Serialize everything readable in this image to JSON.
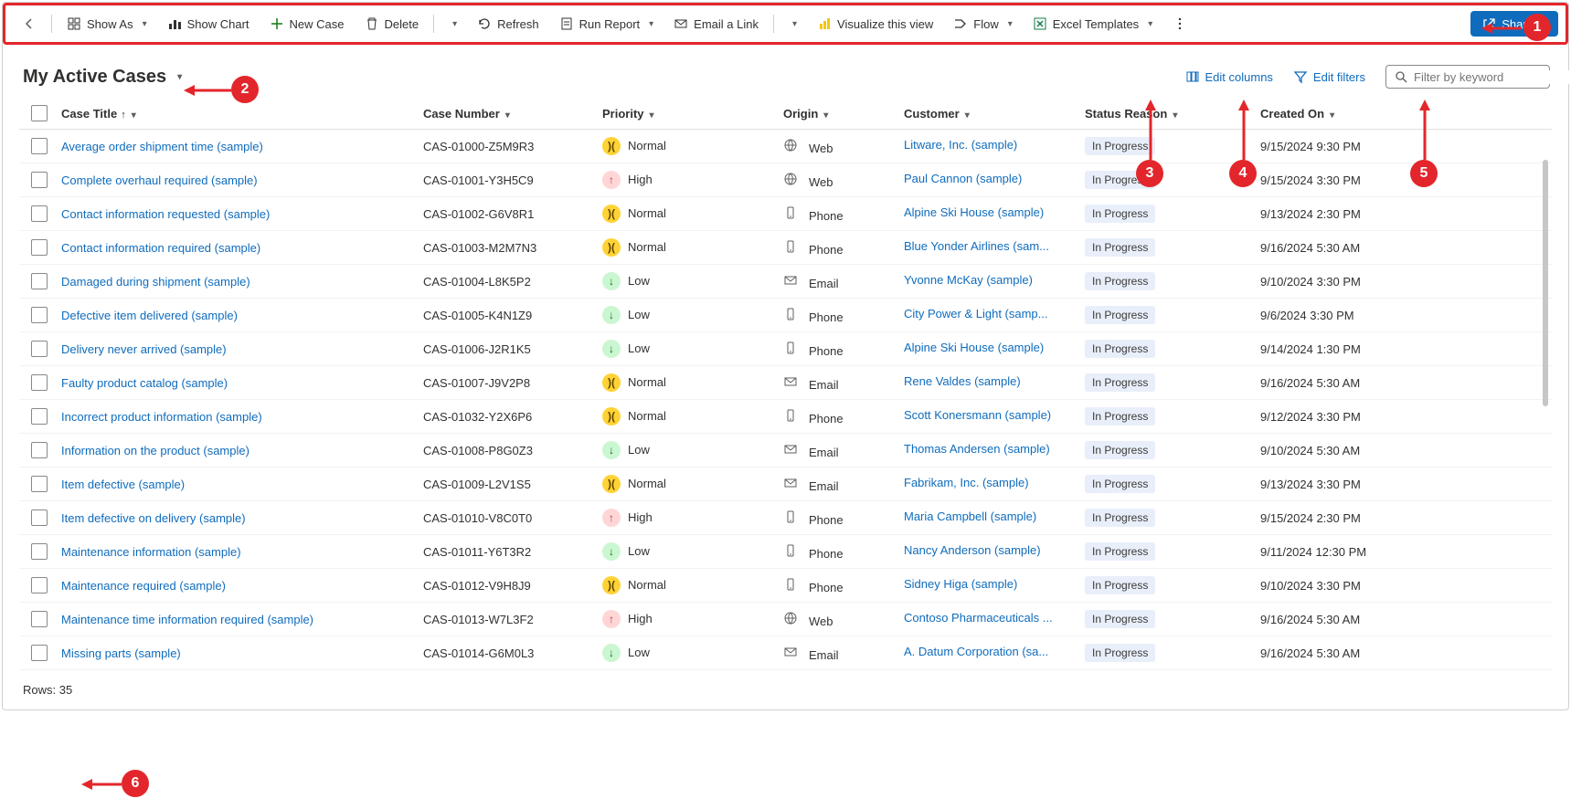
{
  "commands": {
    "showAs": "Show As",
    "showChart": "Show Chart",
    "newCase": "New Case",
    "delete": "Delete",
    "refresh": "Refresh",
    "runReport": "Run Report",
    "emailLink": "Email a Link",
    "visualize": "Visualize this view",
    "flow": "Flow",
    "excel": "Excel Templates",
    "share": "Share"
  },
  "view": {
    "title": "My Active Cases",
    "editColumns": "Edit columns",
    "editFilters": "Edit filters",
    "searchPlaceholder": "Filter by keyword"
  },
  "columns": {
    "title": "Case Title",
    "case": "Case Number",
    "priority": "Priority",
    "origin": "Origin",
    "customer": "Customer",
    "status": "Status Reason",
    "created": "Created On"
  },
  "footer": {
    "rows": "Rows: 35"
  },
  "rows": [
    {
      "title": "Average order shipment time (sample)",
      "case": "CAS-01000-Z5M9R3",
      "priority": "Normal",
      "priLevel": "normal",
      "origin": "Web",
      "originIcon": "web",
      "customer": "Litware, Inc. (sample)",
      "status": "In Progress",
      "created": "9/15/2024 9:30 PM"
    },
    {
      "title": "Complete overhaul required (sample)",
      "case": "CAS-01001-Y3H5C9",
      "priority": "High",
      "priLevel": "high",
      "origin": "Web",
      "originIcon": "web",
      "customer": "Paul Cannon (sample)",
      "status": "In Progress",
      "created": "9/15/2024 3:30 PM"
    },
    {
      "title": "Contact information requested (sample)",
      "case": "CAS-01002-G6V8R1",
      "priority": "Normal",
      "priLevel": "normal",
      "origin": "Phone",
      "originIcon": "phone",
      "customer": "Alpine Ski House (sample)",
      "status": "In Progress",
      "created": "9/13/2024 2:30 PM"
    },
    {
      "title": "Contact information required (sample)",
      "case": "CAS-01003-M2M7N3",
      "priority": "Normal",
      "priLevel": "normal",
      "origin": "Phone",
      "originIcon": "phone",
      "customer": "Blue Yonder Airlines (sam...",
      "status": "In Progress",
      "created": "9/16/2024 5:30 AM"
    },
    {
      "title": "Damaged during shipment (sample)",
      "case": "CAS-01004-L8K5P2",
      "priority": "Low",
      "priLevel": "low",
      "origin": "Email",
      "originIcon": "email",
      "customer": "Yvonne McKay (sample)",
      "status": "In Progress",
      "created": "9/10/2024 3:30 PM"
    },
    {
      "title": "Defective item delivered (sample)",
      "case": "CAS-01005-K4N1Z9",
      "priority": "Low",
      "priLevel": "low",
      "origin": "Phone",
      "originIcon": "phone",
      "customer": "City Power & Light (samp...",
      "status": "In Progress",
      "created": "9/6/2024 3:30 PM"
    },
    {
      "title": "Delivery never arrived (sample)",
      "case": "CAS-01006-J2R1K5",
      "priority": "Low",
      "priLevel": "low",
      "origin": "Phone",
      "originIcon": "phone",
      "customer": "Alpine Ski House (sample)",
      "status": "In Progress",
      "created": "9/14/2024 1:30 PM"
    },
    {
      "title": "Faulty product catalog (sample)",
      "case": "CAS-01007-J9V2P8",
      "priority": "Normal",
      "priLevel": "normal",
      "origin": "Email",
      "originIcon": "email",
      "customer": "Rene Valdes (sample)",
      "status": "In Progress",
      "created": "9/16/2024 5:30 AM"
    },
    {
      "title": "Incorrect product information (sample)",
      "case": "CAS-01032-Y2X6P6",
      "priority": "Normal",
      "priLevel": "normal",
      "origin": "Phone",
      "originIcon": "phone",
      "customer": "Scott Konersmann (sample)",
      "status": "In Progress",
      "created": "9/12/2024 3:30 PM"
    },
    {
      "title": "Information on the product (sample)",
      "case": "CAS-01008-P8G0Z3",
      "priority": "Low",
      "priLevel": "low",
      "origin": "Email",
      "originIcon": "email",
      "customer": "Thomas Andersen (sample)",
      "status": "In Progress",
      "created": "9/10/2024 5:30 AM"
    },
    {
      "title": "Item defective (sample)",
      "case": "CAS-01009-L2V1S5",
      "priority": "Normal",
      "priLevel": "normal",
      "origin": "Email",
      "originIcon": "email",
      "customer": "Fabrikam, Inc. (sample)",
      "status": "In Progress",
      "created": "9/13/2024 3:30 PM"
    },
    {
      "title": "Item defective on delivery (sample)",
      "case": "CAS-01010-V8C0T0",
      "priority": "High",
      "priLevel": "high",
      "origin": "Phone",
      "originIcon": "phone",
      "customer": "Maria Campbell (sample)",
      "status": "In Progress",
      "created": "9/15/2024 2:30 PM"
    },
    {
      "title": "Maintenance information (sample)",
      "case": "CAS-01011-Y6T3R2",
      "priority": "Low",
      "priLevel": "low",
      "origin": "Phone",
      "originIcon": "phone",
      "customer": "Nancy Anderson (sample)",
      "status": "In Progress",
      "created": "9/11/2024 12:30 PM"
    },
    {
      "title": "Maintenance required (sample)",
      "case": "CAS-01012-V9H8J9",
      "priority": "Normal",
      "priLevel": "normal",
      "origin": "Phone",
      "originIcon": "phone",
      "customer": "Sidney Higa (sample)",
      "status": "In Progress",
      "created": "9/10/2024 3:30 PM"
    },
    {
      "title": "Maintenance time information required (sample)",
      "case": "CAS-01013-W7L3F2",
      "priority": "High",
      "priLevel": "high",
      "origin": "Web",
      "originIcon": "web",
      "customer": "Contoso Pharmaceuticals ...",
      "status": "In Progress",
      "created": "9/16/2024 5:30 AM"
    },
    {
      "title": "Missing parts (sample)",
      "case": "CAS-01014-G6M0L3",
      "priority": "Low",
      "priLevel": "low",
      "origin": "Email",
      "originIcon": "email",
      "customer": "A. Datum Corporation (sa...",
      "status": "In Progress",
      "created": "9/16/2024 5:30 AM"
    }
  ]
}
